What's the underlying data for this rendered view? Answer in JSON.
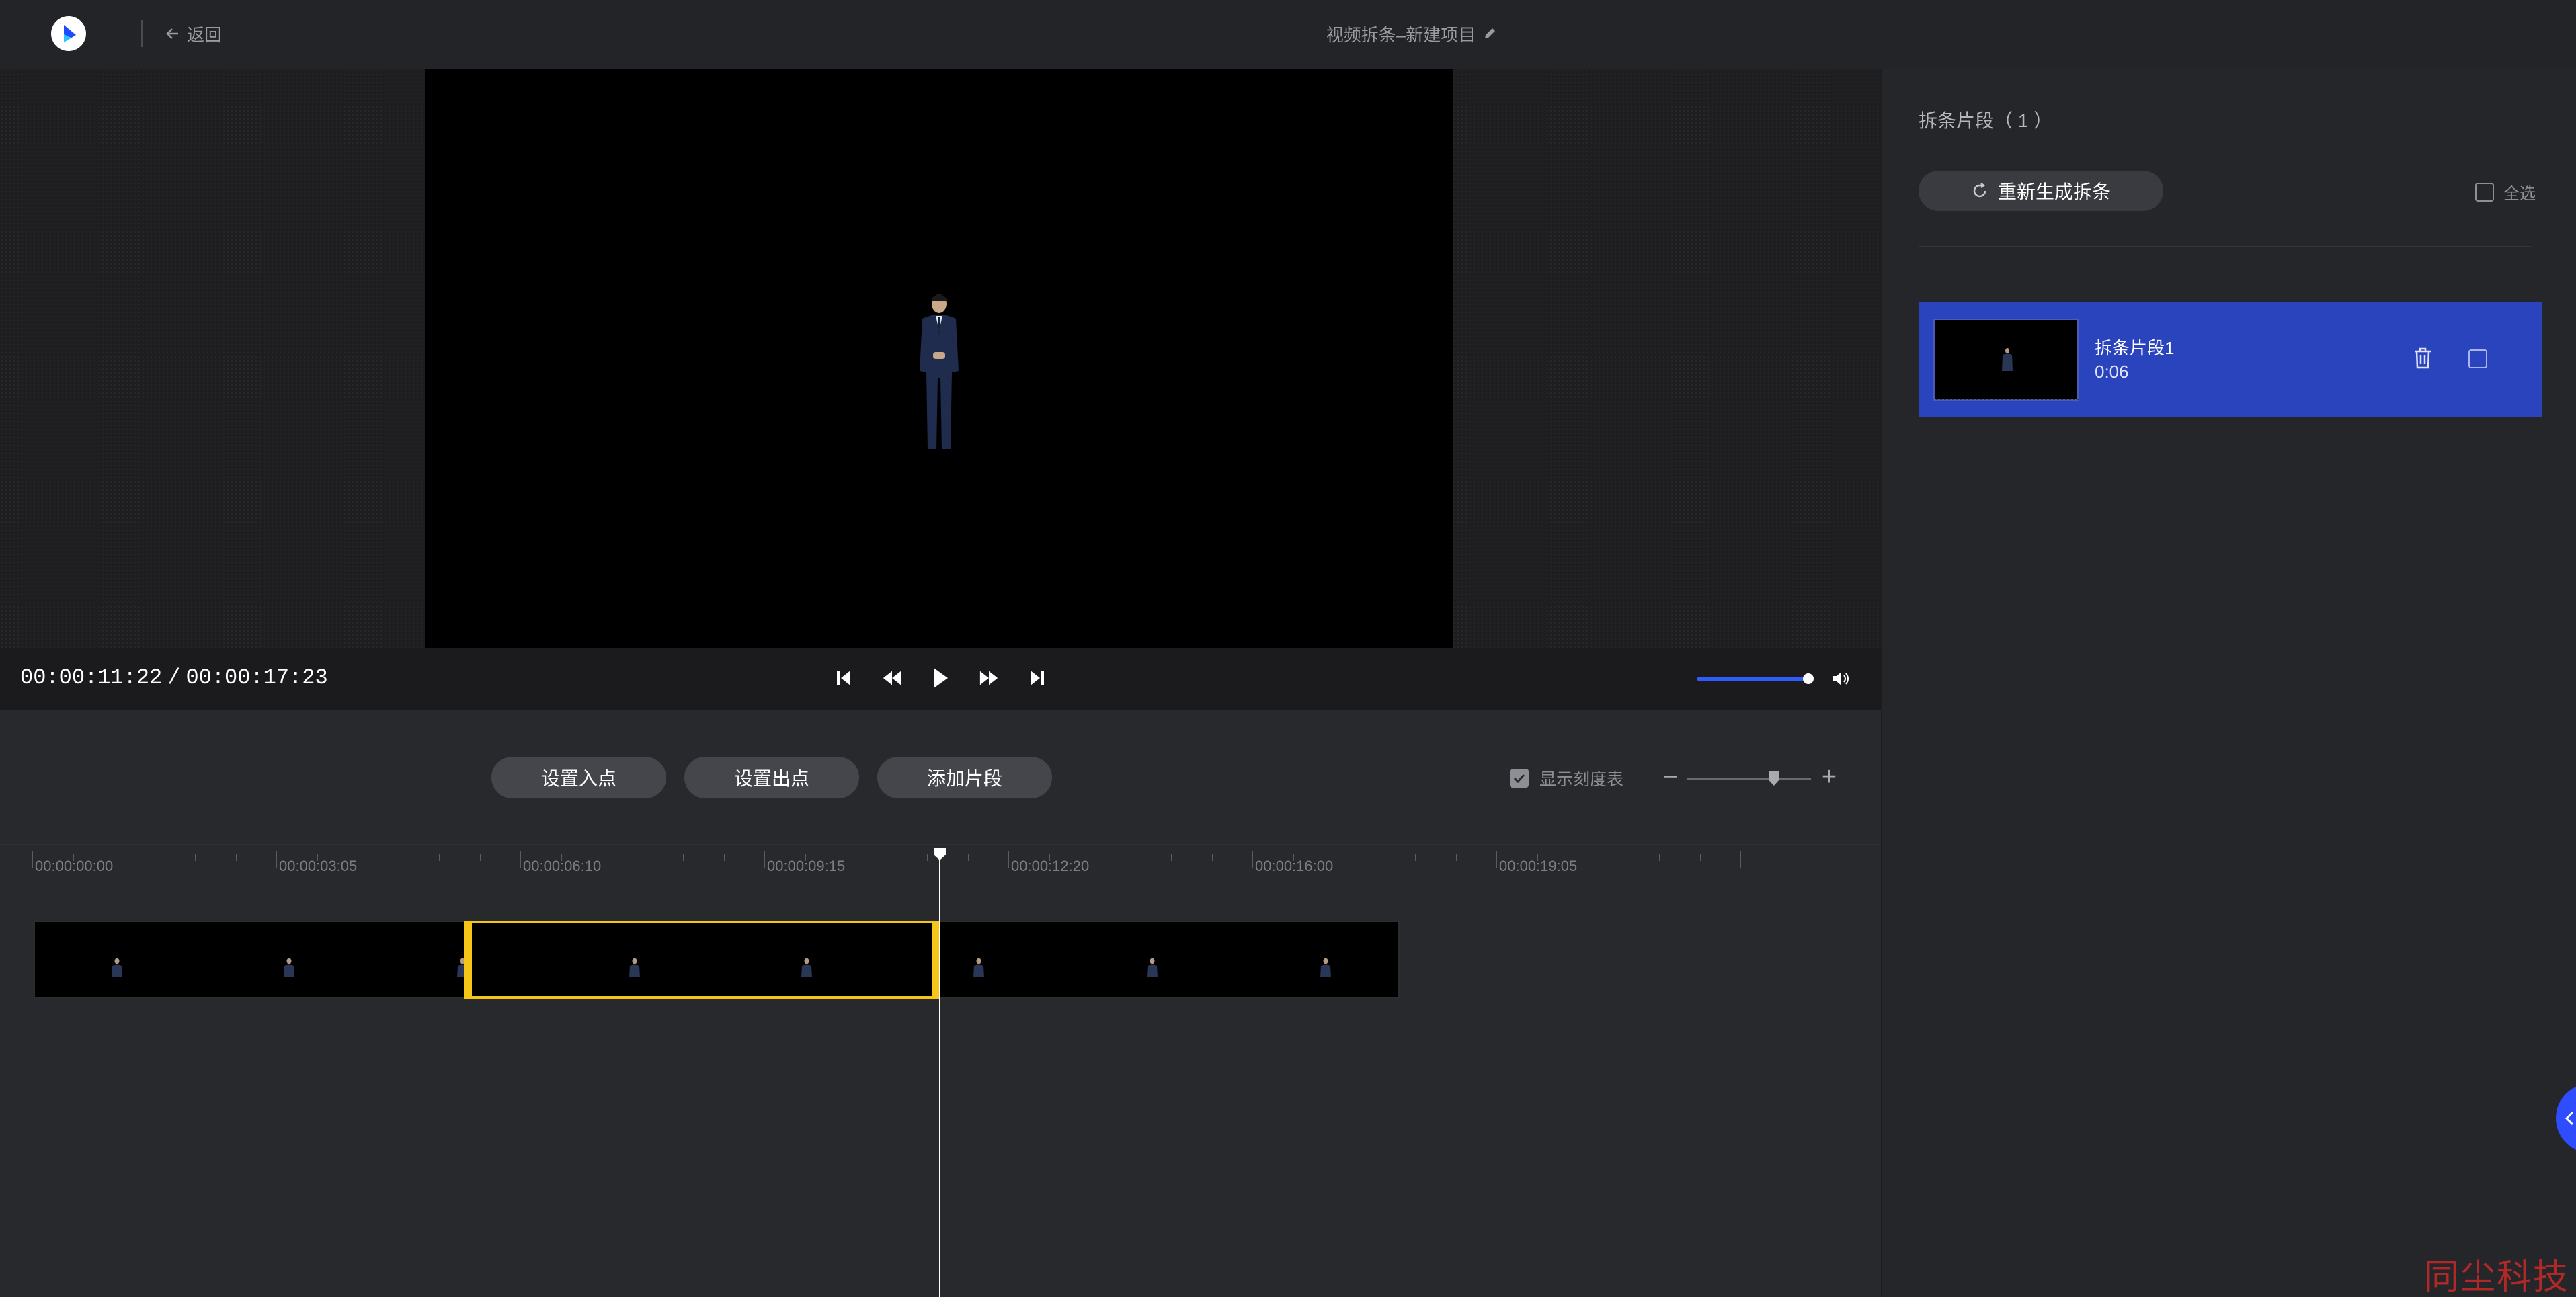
{
  "header": {
    "logo_icon": "app-logo-icon",
    "back_label": "返回",
    "project_title": "视频拆条–新建项目"
  },
  "player": {
    "current_time": "00:00:11:22",
    "separator": "/",
    "total_time": "00:00:17:23",
    "volume_level": 0.92,
    "accent_color": "#2f5bff"
  },
  "toolbar": {
    "set_in_label": "设置入点",
    "set_out_label": "设置出点",
    "add_clip_label": "添加片段",
    "show_scale_label": "显示刻度表",
    "show_scale_checked": true,
    "zoom_minus": "−",
    "zoom_plus": "+",
    "zoom_level": 0.7
  },
  "timeline": {
    "ticks": [
      "00:00:00:00",
      "00:00:03:05",
      "00:00:06:10",
      "00:00:09:15",
      "00:00:12:20",
      "00:00:16:00",
      "00:00:19:05"
    ],
    "selection_color": "#f5c518"
  },
  "panel": {
    "title": "拆条片段（ 1 ）",
    "regenerate_label": "重新生成拆条",
    "select_all_label": "全选",
    "clips": [
      {
        "name": "拆条片段1",
        "duration": "0:06"
      }
    ]
  },
  "watermark": "同尘科技"
}
